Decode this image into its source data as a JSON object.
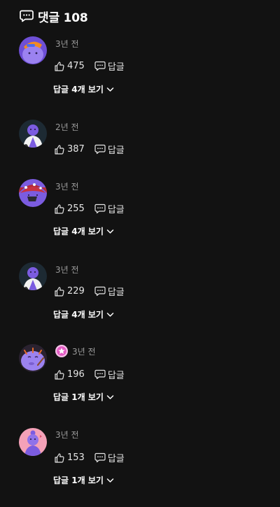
{
  "header": {
    "title": "댓글 108",
    "icon": "speech-bubble-icon"
  },
  "labels": {
    "reply": "답글"
  },
  "comments": [
    {
      "time": "3년 전",
      "likes": "475",
      "replies_label": "답글 4개 보기",
      "avatar": "purple-blob-orange-cap",
      "badge": null
    },
    {
      "time": "2년 전",
      "likes": "387",
      "replies_label": null,
      "avatar": "purple-man-white-robe",
      "badge": null
    },
    {
      "time": "3년 전",
      "likes": "255",
      "replies_label": "답글 4개 보기",
      "avatar": "purple-blob-red-mushroom-hat",
      "badge": null
    },
    {
      "time": "3년 전",
      "likes": "229",
      "replies_label": "답글 4개 보기",
      "avatar": "purple-man-white-robe",
      "badge": null
    },
    {
      "time": "3년 전",
      "likes": "196",
      "replies_label": "답글 1개 보기",
      "avatar": "purple-blob-eating",
      "badge": "pink-star-badge"
    },
    {
      "time": "3년 전",
      "likes": "153",
      "replies_label": "답글 1개 보기",
      "avatar": "purple-girl-pink-bg",
      "badge": null
    }
  ],
  "colors": {
    "background": "#121212",
    "text": "#e6e6e6",
    "muted": "#9a9a9a",
    "avatar_purple": "#7b5ce0"
  }
}
